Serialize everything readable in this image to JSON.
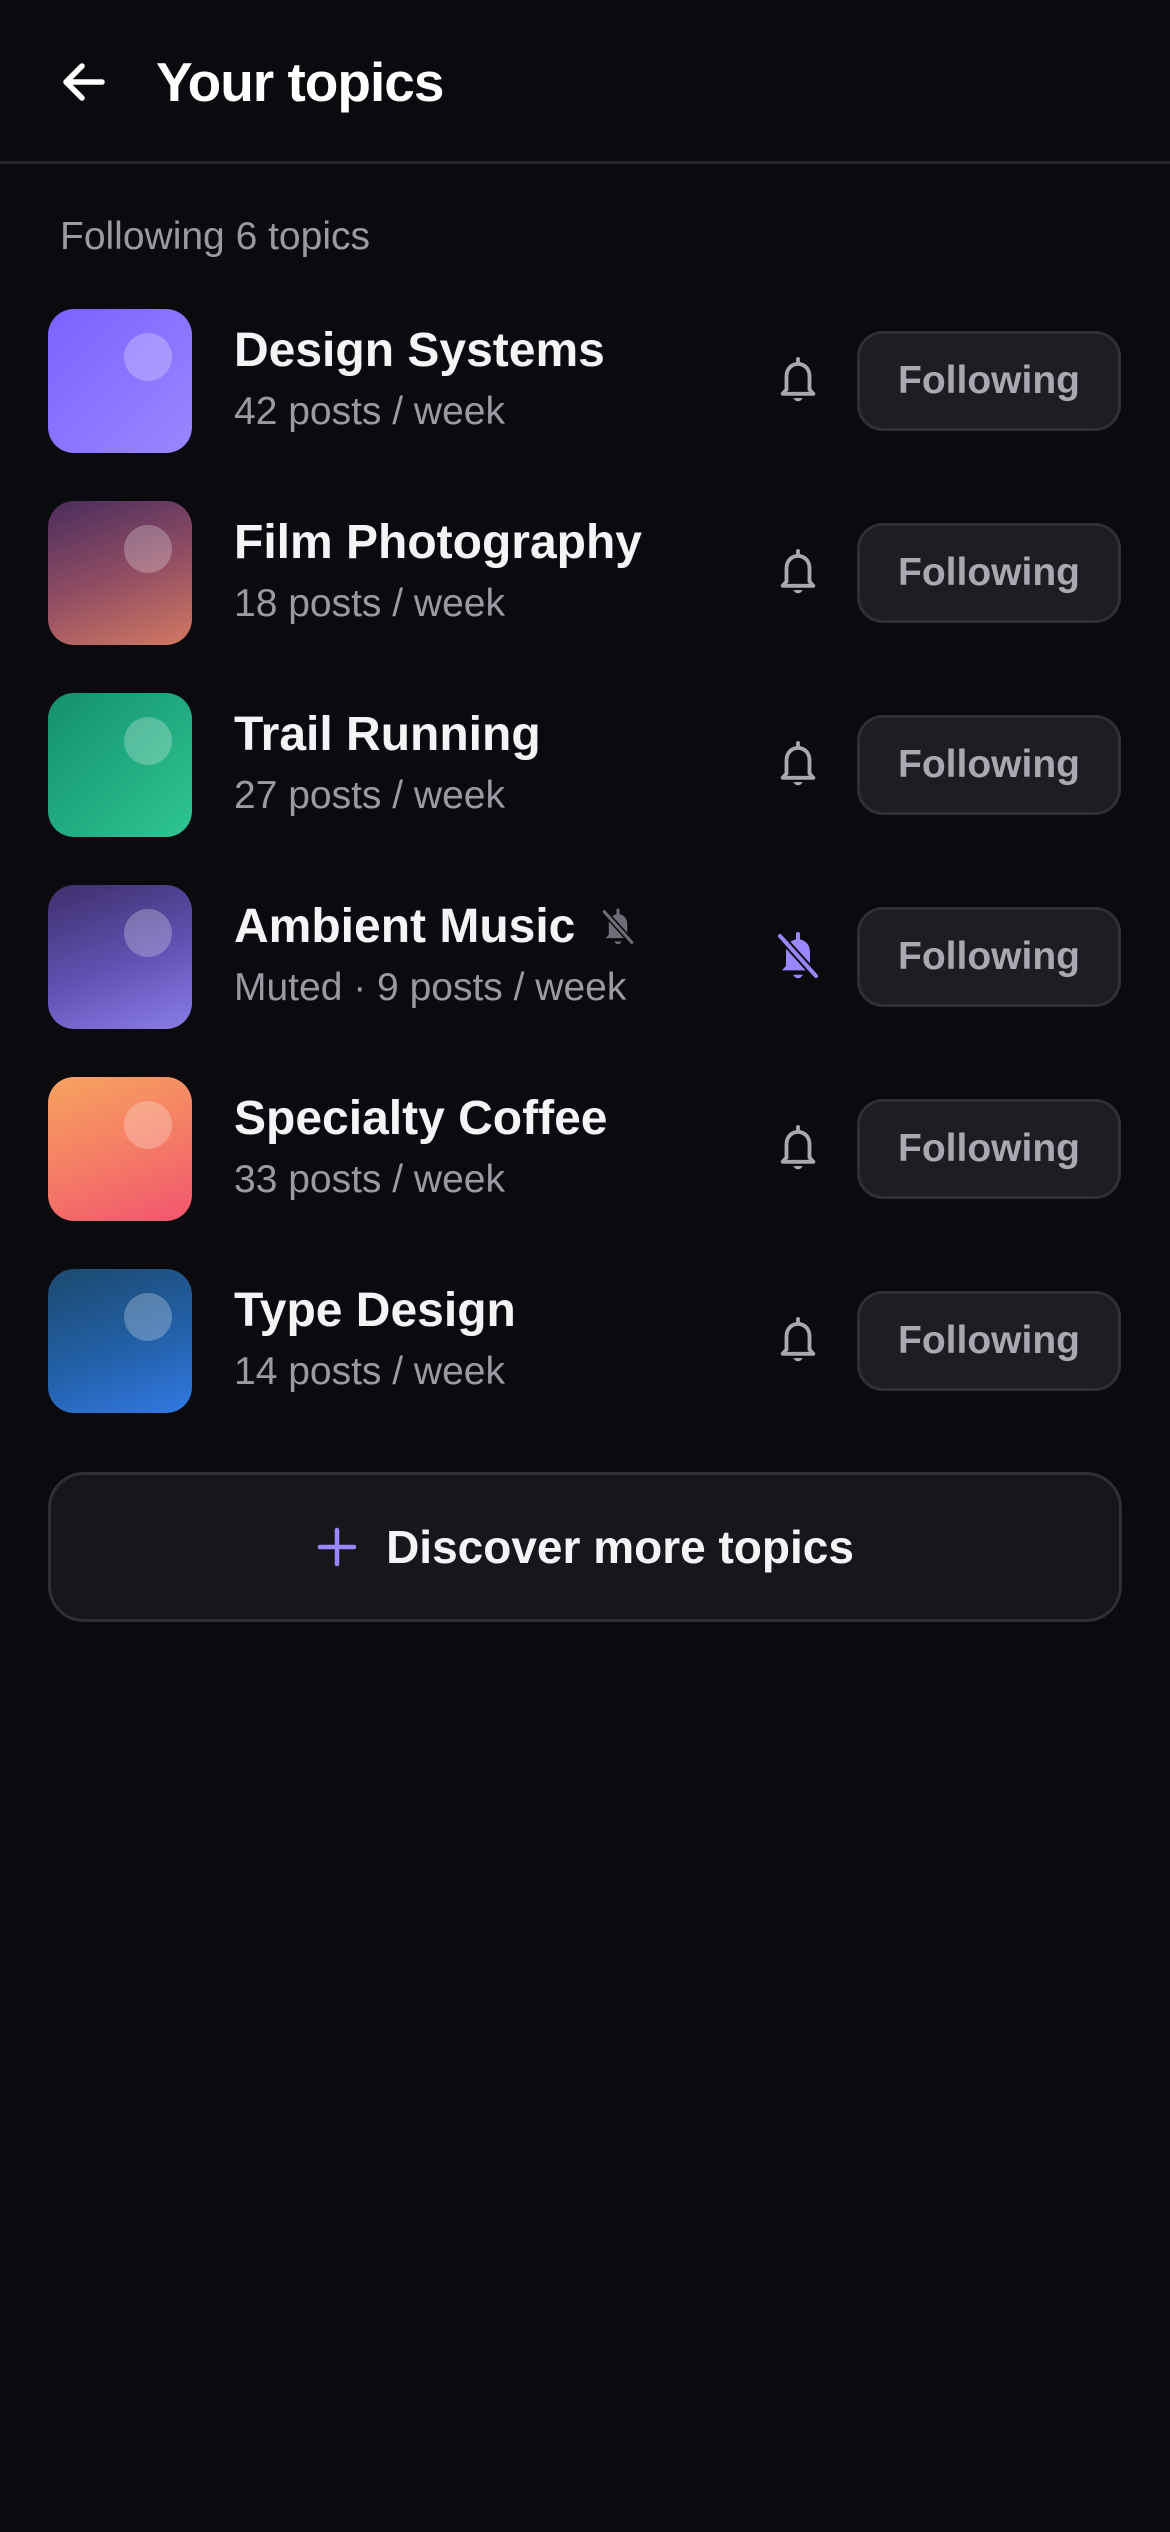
{
  "header": {
    "title": "Your topics",
    "back_icon": "arrow-left-icon"
  },
  "section": {
    "label": "Following 6 topics"
  },
  "colors": {
    "background": "#0b0b0f",
    "accent": "#9a86ff",
    "muted_text": "#9b9aa4",
    "button_bg": "#1d1d22"
  },
  "topics": [
    {
      "name": "Design Systems",
      "meta": "42 posts / week",
      "button_label": "Following",
      "muted": false,
      "bell_icon": "bell-icon"
    },
    {
      "name": "Film Photography",
      "meta": "18 posts / week",
      "button_label": "Following",
      "muted": false,
      "bell_icon": "bell-icon"
    },
    {
      "name": "Trail Running",
      "meta": "27 posts / week",
      "button_label": "Following",
      "muted": false,
      "bell_icon": "bell-icon"
    },
    {
      "name": "Ambient Music",
      "meta": "Muted · 9 posts / week",
      "button_label": "Following",
      "muted": true,
      "bell_icon": "bell-off-icon"
    },
    {
      "name": "Specialty Coffee",
      "meta": "33 posts / week",
      "button_label": "Following",
      "muted": false,
      "bell_icon": "bell-icon"
    },
    {
      "name": "Type Design",
      "meta": "14 posts / week",
      "button_label": "Following",
      "muted": false,
      "bell_icon": "bell-icon"
    }
  ],
  "discover": {
    "label": "Discover more topics",
    "icon": "plus-icon"
  }
}
